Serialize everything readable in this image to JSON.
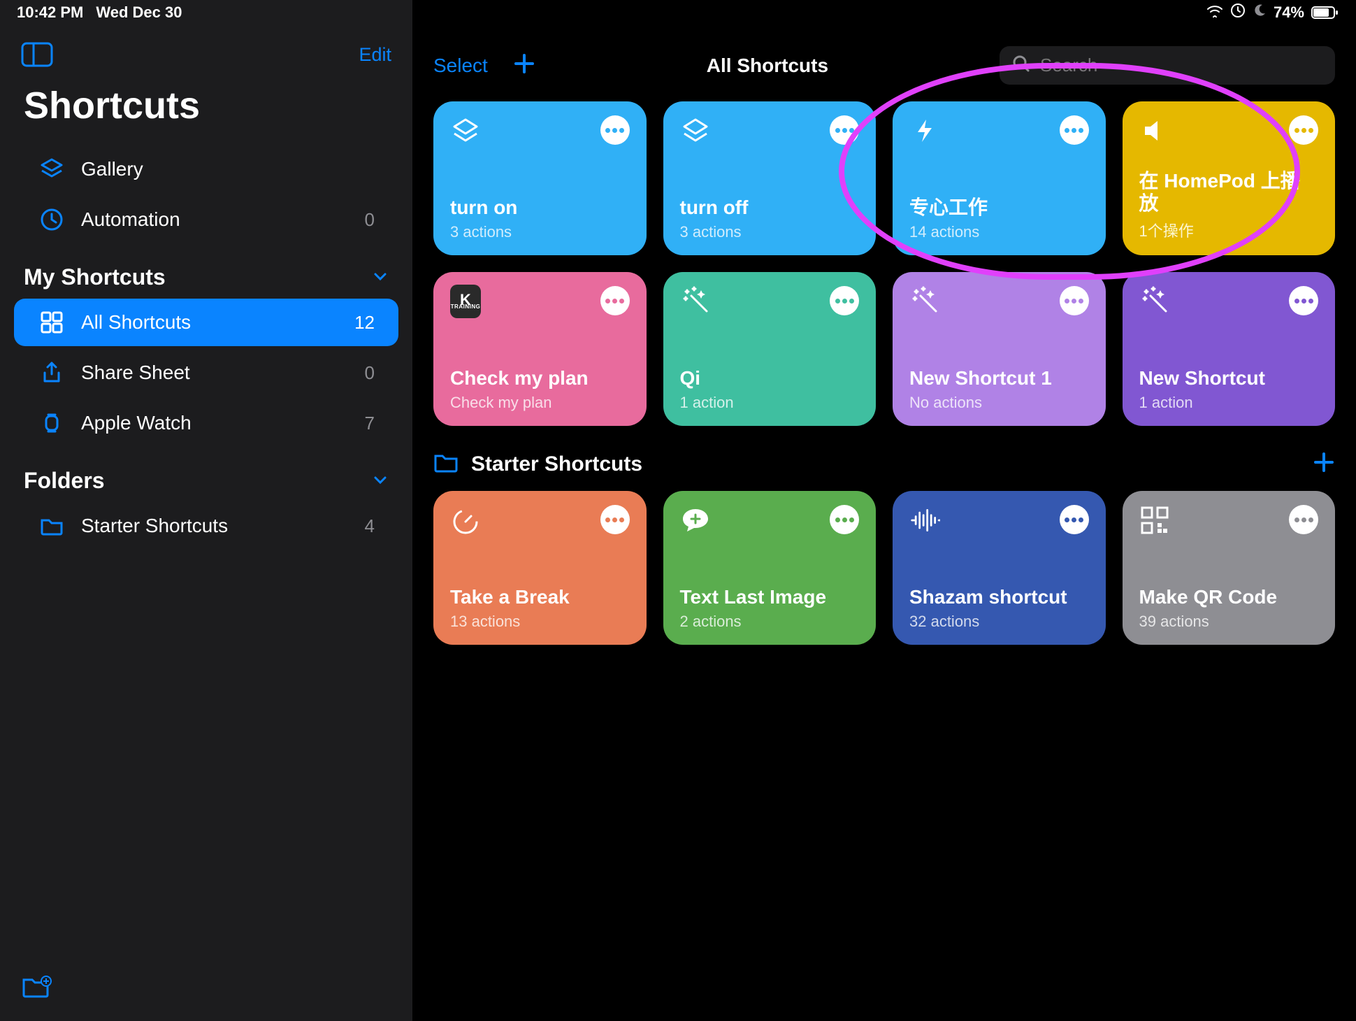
{
  "status": {
    "time": "10:42 PM",
    "date": "Wed Dec 30",
    "battery_pct": "74%"
  },
  "sidebar": {
    "edit": "Edit",
    "title": "Shortcuts",
    "gallery": "Gallery",
    "automation": {
      "label": "Automation",
      "count": "0"
    },
    "section_my": "My Shortcuts",
    "all_shortcuts": {
      "label": "All Shortcuts",
      "count": "12"
    },
    "share_sheet": {
      "label": "Share Sheet",
      "count": "0"
    },
    "apple_watch": {
      "label": "Apple Watch",
      "count": "7"
    },
    "section_folders": "Folders",
    "starter": {
      "label": "Starter Shortcuts",
      "count": "4"
    }
  },
  "header": {
    "select": "Select",
    "title": "All Shortcuts",
    "search_placeholder": "Search"
  },
  "shortcuts": [
    {
      "title": "turn on",
      "sub": "3 actions",
      "color": "c-skyblue",
      "icon": "layers"
    },
    {
      "title": "turn off",
      "sub": "3 actions",
      "color": "c-skyblue",
      "icon": "layers"
    },
    {
      "title": "专心工作",
      "sub": "14 actions",
      "color": "c-skyblue",
      "icon": "bolt"
    },
    {
      "title": "在 HomePod 上播放",
      "sub": "1个操作",
      "color": "c-yellow",
      "icon": "speaker"
    },
    {
      "title": "Check my plan",
      "sub": "Check my plan",
      "color": "c-pink",
      "icon": "keep"
    },
    {
      "title": "Qi",
      "sub": "1 action",
      "color": "c-teal",
      "icon": "wand"
    },
    {
      "title": "New Shortcut 1",
      "sub": "No actions",
      "color": "c-lilac",
      "icon": "wand"
    },
    {
      "title": "New Shortcut",
      "sub": "1 action",
      "color": "c-purple",
      "icon": "wand"
    }
  ],
  "starter_section": {
    "label": "Starter Shortcuts",
    "items": [
      {
        "title": "Take a Break",
        "sub": "13 actions",
        "color": "c-orange",
        "icon": "timer"
      },
      {
        "title": "Text Last Image",
        "sub": "2 actions",
        "color": "c-green",
        "icon": "chat-plus"
      },
      {
        "title": "Shazam shortcut",
        "sub": "32 actions",
        "color": "c-blue2",
        "icon": "wave"
      },
      {
        "title": "Make QR Code",
        "sub": "39 actions",
        "color": "c-gray",
        "icon": "qr"
      }
    ]
  }
}
